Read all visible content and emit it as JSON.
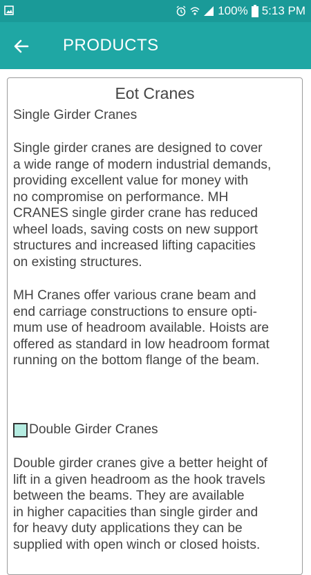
{
  "status_bar": {
    "battery": "100%",
    "time": "5:13 PM",
    "icons": [
      "image-icon",
      "alarm-icon",
      "wifi-icon",
      "signal-icon",
      "battery-icon"
    ]
  },
  "app_bar": {
    "title": "PRODUCTS",
    "back_icon": "arrow-left-icon"
  },
  "content": {
    "heading": "Eot Cranes",
    "section1_title": "Single Girder Cranes",
    "section1_para1": "Single girder cranes are designed to cover\na wide range of modern industrial demands,\nproviding excellent value for money with\nno compromise on performance. MH\nCRANES single girder crane has reduced\nwheel loads, saving costs on new support\nstructures and increased lifting capacities\non existing structures.",
    "section1_para2": "MH Cranes offer various crane beam and\nend carriage constructions to ensure opti-\nmum use of headroom available. Hoists are\noffered as standard in low headroom format\nrunning on the bottom flange of the beam.",
    "section2_title": "Double Girder Cranes",
    "section2_para1": "Double girder cranes give a better height of\nlift in a given headroom as the hook travels\nbetween the beams. They are available\nin higher capacities than single girder and\nfor heavy duty applications they can be\nsupplied with open winch or closed hoists."
  },
  "colors": {
    "status_bar": "#1a9a98",
    "app_bar": "#1fa7a4",
    "swatch": "#b5ece1"
  }
}
